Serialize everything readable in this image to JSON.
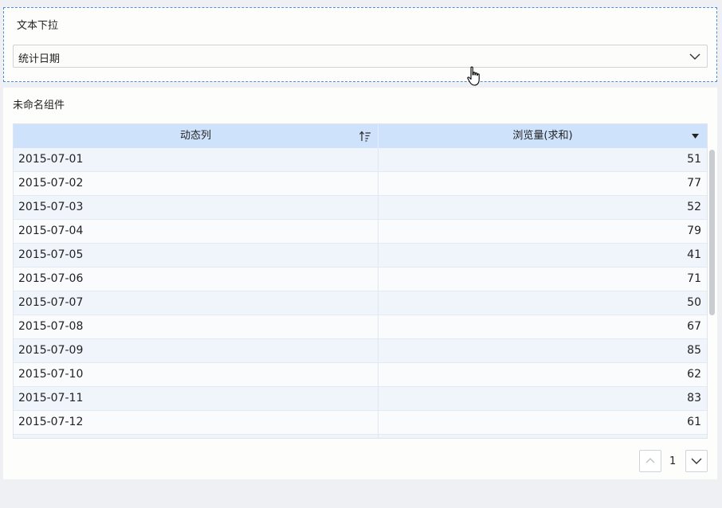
{
  "dropdown": {
    "title": "文本下拉",
    "selected": "统计日期"
  },
  "table_widget": {
    "title": "未命名组件",
    "columns": [
      "动态列",
      "浏览量(求和)"
    ],
    "rows": [
      {
        "date": "2015-07-01",
        "value": "51"
      },
      {
        "date": "2015-07-02",
        "value": "77"
      },
      {
        "date": "2015-07-03",
        "value": "52"
      },
      {
        "date": "2015-07-04",
        "value": "79"
      },
      {
        "date": "2015-07-05",
        "value": "41"
      },
      {
        "date": "2015-07-06",
        "value": "71"
      },
      {
        "date": "2015-07-07",
        "value": "50"
      },
      {
        "date": "2015-07-08",
        "value": "67"
      },
      {
        "date": "2015-07-09",
        "value": "85"
      },
      {
        "date": "2015-07-10",
        "value": "62"
      },
      {
        "date": "2015-07-11",
        "value": "83"
      },
      {
        "date": "2015-07-12",
        "value": "61"
      }
    ],
    "pagination": {
      "current_page": "1"
    }
  },
  "colors": {
    "header_bg": "#cfe2fb",
    "selection_border": "#4a8fd8",
    "page_bg": "#eef0f4"
  },
  "icons": {
    "select_arrow": "chevron-down-icon",
    "sort": "sort-ascending-icon",
    "column_menu": "caret-down-icon",
    "pager_prev": "chevron-up-icon",
    "pager_next": "chevron-down-icon",
    "cursor": "hand-pointer-icon"
  }
}
